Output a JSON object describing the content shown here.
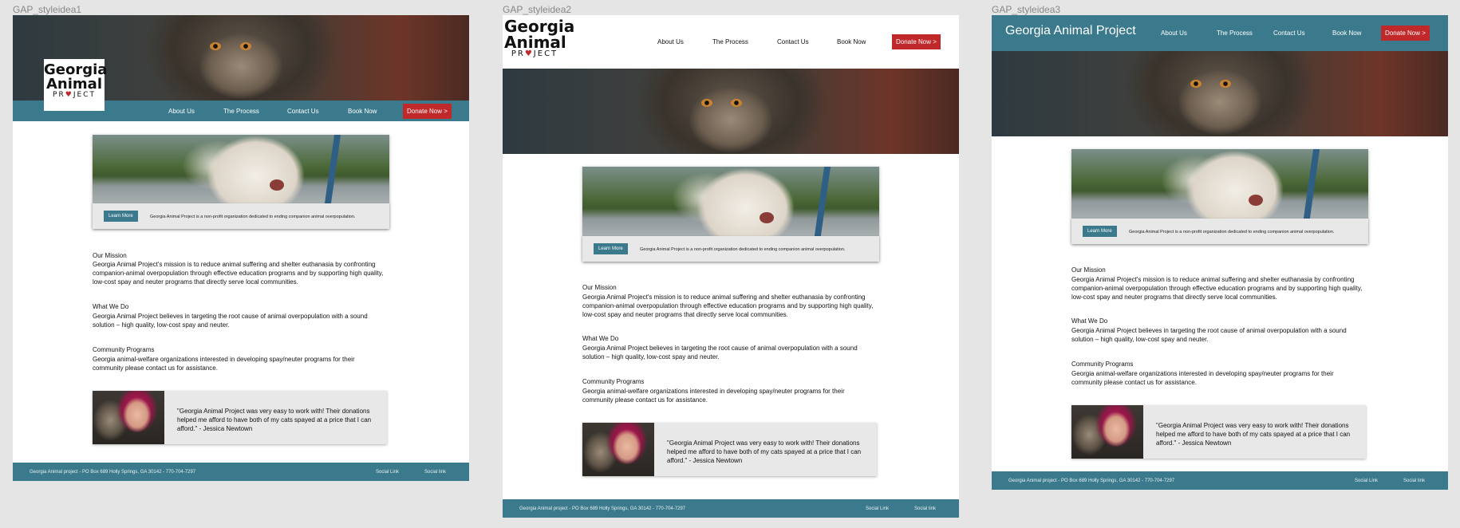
{
  "frames": [
    {
      "label": "GAP_styleidea1"
    },
    {
      "label": "GAP_styleidea2"
    },
    {
      "label": "GAP_styleidea3"
    }
  ],
  "logo": {
    "line1": "Georgia",
    "line2": "Animal",
    "line3_a": "PR",
    "heart": "♥",
    "line3_b": "JECT"
  },
  "brand_text": "Georgia Animal Project",
  "nav": {
    "about": "About Us",
    "process": "The Process",
    "contact": "Contact Us",
    "book": "Book Now",
    "donate": "Donate Now  >"
  },
  "hero": {
    "button": "Learn More",
    "text": "Georgia Animal Project is a non-profit organization dedicated to ending companion animal overpopulation."
  },
  "sections": {
    "mission_title": "Our Mission",
    "mission_body": "Georgia Animal Project's mission is to reduce animal suffering and shelter euthanasia by confronting companion-animal overpopulation through effective education programs and by supporting high quality, low-cost spay and neuter programs that directly serve local communities.",
    "whatwedo_title": "What We Do",
    "whatwedo_body": "Georgia Animal Project believes in targeting the root cause of animal overpopulation with a sound solution – high quality, low-cost spay and neuter.",
    "community_title": "Community Programs",
    "community_body": "Georgia animal-welfare organizations interested in developing spay/neuter programs for their community please contact us for assistance."
  },
  "testimonial": "\"Georgia Animal Project was very easy to work with! Their donations helped me afford to have both of my cats spayed at a price that I can afford.\" - Jessica Newtown",
  "footer": {
    "address": "Georgia Animal project - PO Box 689 Holly Springs, GA 30142 - 770-704-7297",
    "social1": "Social Link",
    "social2": "Social link"
  },
  "colors": {
    "teal": "#3a7a8c",
    "donate_red": "#c0282a",
    "canvas": "#e5e5e5"
  }
}
